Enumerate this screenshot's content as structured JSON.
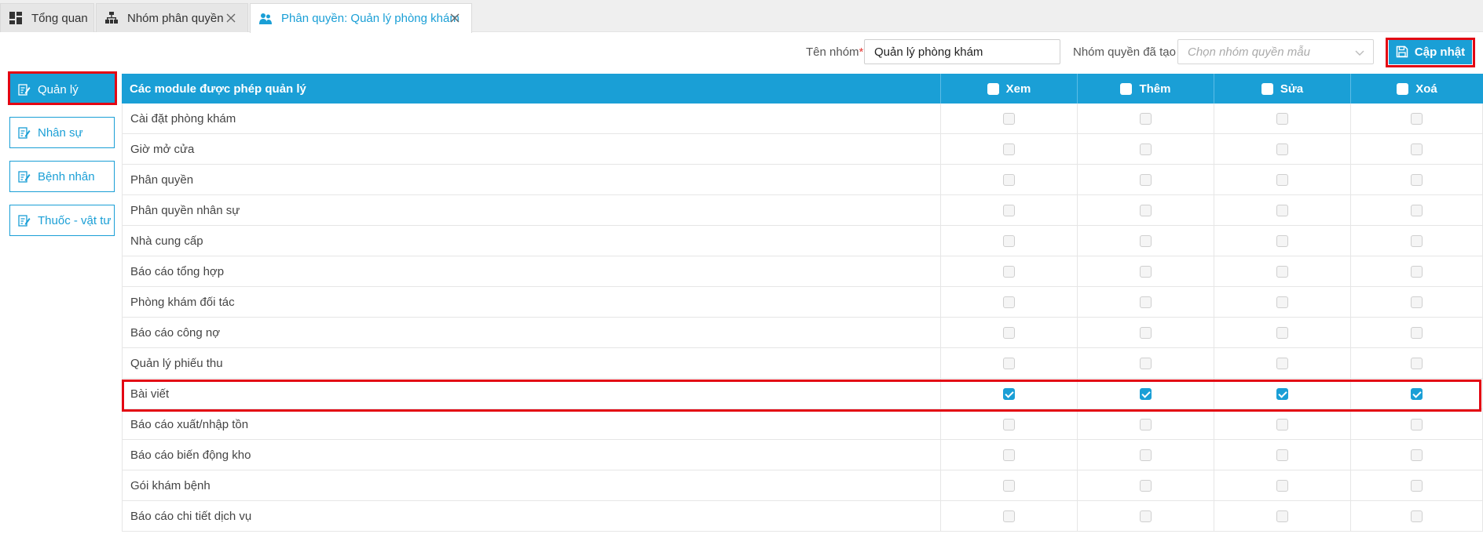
{
  "tabs": [
    {
      "label": "Tổng quan",
      "icon": "dashboard-icon",
      "closable": false
    },
    {
      "label": "Nhóm phân quyền",
      "icon": "org-chart-icon",
      "closable": true
    },
    {
      "label": "Phân quyền: Quản lý phòng khám",
      "icon": "users-icon",
      "closable": true,
      "active": true
    }
  ],
  "toolbar": {
    "group_name_label": "Tên nhóm",
    "required_mark": "*",
    "group_name_value": "Quản lý phòng khám",
    "template_label": "Nhóm quyền đã tạo :",
    "template_placeholder": "Chọn nhóm quyền mẫu",
    "update_label": "Cập nhật"
  },
  "sidebar": {
    "items": [
      {
        "label": "Quản lý",
        "active": true
      },
      {
        "label": "Nhân sự",
        "active": false
      },
      {
        "label": "Bệnh nhân",
        "active": false
      },
      {
        "label": "Thuốc - vật tư",
        "active": false
      }
    ]
  },
  "table": {
    "headers": {
      "module": "Các module được phép quản lý",
      "view": "Xem",
      "add": "Thêm",
      "edit": "Sửa",
      "delete": "Xoá"
    },
    "rows": [
      {
        "name": "Cài đặt phòng khám",
        "view": false,
        "add": false,
        "edit": false,
        "delete": false
      },
      {
        "name": "Giờ mở cửa",
        "view": false,
        "add": false,
        "edit": false,
        "delete": false
      },
      {
        "name": "Phân quyền",
        "view": false,
        "add": false,
        "edit": false,
        "delete": false
      },
      {
        "name": "Phân quyền nhân sự",
        "view": false,
        "add": false,
        "edit": false,
        "delete": false
      },
      {
        "name": "Nhà cung cấp",
        "view": false,
        "add": false,
        "edit": false,
        "delete": false
      },
      {
        "name": "Báo cáo tổng hợp",
        "view": false,
        "add": false,
        "edit": false,
        "delete": false
      },
      {
        "name": "Phòng khám đối tác",
        "view": false,
        "add": false,
        "edit": false,
        "delete": false
      },
      {
        "name": "Báo cáo công nợ",
        "view": false,
        "add": false,
        "edit": false,
        "delete": false
      },
      {
        "name": "Quản lý phiếu thu",
        "view": false,
        "add": false,
        "edit": false,
        "delete": false
      },
      {
        "name": "Bài viết",
        "view": true,
        "add": true,
        "edit": true,
        "delete": true
      },
      {
        "name": "Báo cáo xuất/nhập tồn",
        "view": false,
        "add": false,
        "edit": false,
        "delete": false
      },
      {
        "name": "Báo cáo biến động kho",
        "view": false,
        "add": false,
        "edit": false,
        "delete": false
      },
      {
        "name": "Gói khám bệnh",
        "view": false,
        "add": false,
        "edit": false,
        "delete": false
      },
      {
        "name": "Báo cáo chi tiết dịch vụ",
        "view": false,
        "add": false,
        "edit": false,
        "delete": false
      }
    ]
  },
  "colors": {
    "accent": "#1a9fd6",
    "highlight": "#e30613"
  }
}
